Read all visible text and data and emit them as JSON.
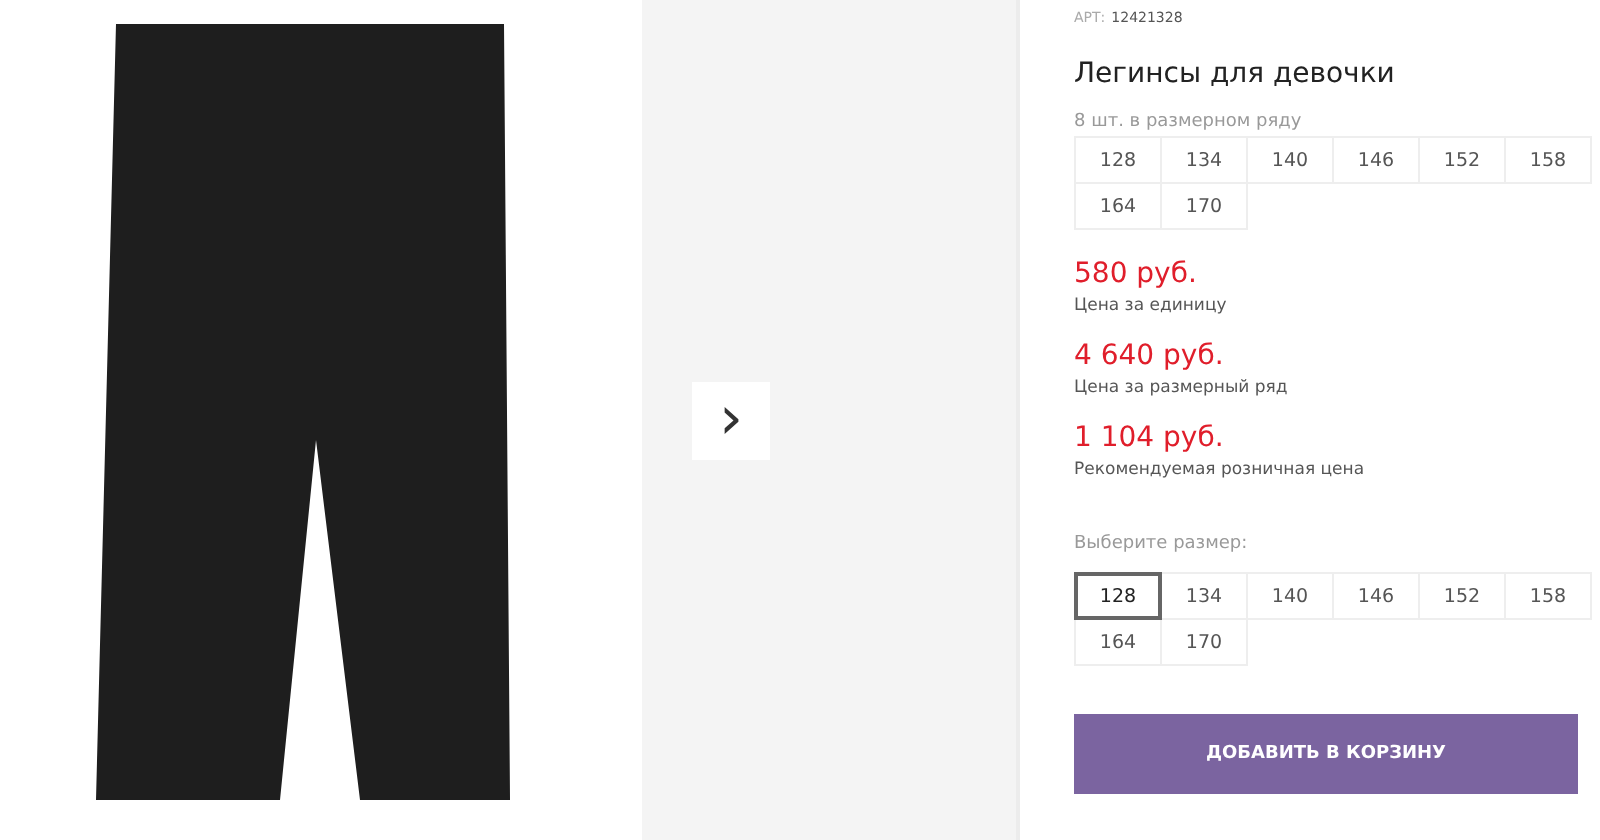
{
  "gallery": {
    "next_button": "›"
  },
  "product": {
    "article_label": "АРТ:",
    "article": "12421328",
    "title": "Легинсы для девочки",
    "pack_label": "8 шт. в размерном ряду",
    "pack_sizes": [
      "128",
      "134",
      "140",
      "146",
      "152",
      "158",
      "164",
      "170"
    ],
    "prices": [
      {
        "value": "580 руб.",
        "caption": "Цена за единицу"
      },
      {
        "value": "4 640 руб.",
        "caption": "Цена за размерный ряд"
      },
      {
        "value": "1 104 руб.",
        "caption": "Рекомендуемая розничная цена"
      }
    ],
    "size_label": "Выберите размер:",
    "sizes": [
      {
        "label": "128",
        "selected": true
      },
      {
        "label": "134",
        "selected": false
      },
      {
        "label": "140",
        "selected": false
      },
      {
        "label": "146",
        "selected": false
      },
      {
        "label": "152",
        "selected": false
      },
      {
        "label": "158",
        "selected": false
      },
      {
        "label": "164",
        "selected": false
      },
      {
        "label": "170",
        "selected": false
      }
    ],
    "add_button": "ДОБАВИТЬ В КОРЗИНУ"
  }
}
